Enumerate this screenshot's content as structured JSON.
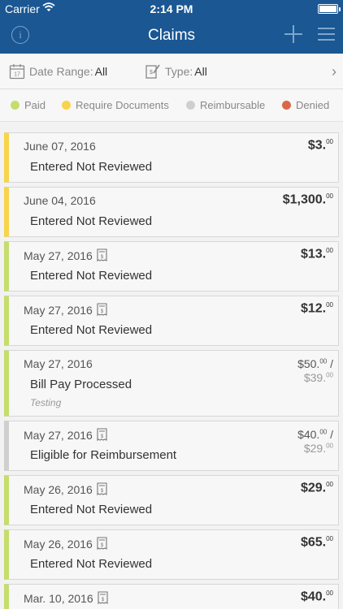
{
  "status_bar": {
    "carrier": "Carrier",
    "time": "2:14 PM"
  },
  "nav": {
    "title": "Claims",
    "info_icon": "info-icon",
    "add_icon": "plus-icon",
    "menu_icon": "hamburger-menu-icon"
  },
  "filters": {
    "date_range_label": "Date Range:",
    "date_range_value": "All",
    "type_label": "Type:",
    "type_value": "All"
  },
  "legend": [
    {
      "label": "Paid",
      "color": "#c5dd6c"
    },
    {
      "label": "Require Documents",
      "color": "#f7d44a"
    },
    {
      "label": "Reimbursable",
      "color": "#cfcfcf"
    },
    {
      "label": "Denied",
      "color": "#d9684b"
    }
  ],
  "claims": [
    {
      "date": "June 07, 2016",
      "status": "Entered Not Reviewed",
      "amount": "$3.",
      "cents": "00",
      "color": "#f7d44a",
      "receipt": false
    },
    {
      "date": "June 04, 2016",
      "status": "Entered Not Reviewed",
      "amount": "$1,300.",
      "cents": "00",
      "color": "#f7d44a",
      "receipt": false
    },
    {
      "date": "May 27, 2016",
      "status": "Entered Not Reviewed",
      "amount": "$13.",
      "cents": "00",
      "color": "#c5dd6c",
      "receipt": true
    },
    {
      "date": "May 27, 2016",
      "status": "Entered Not Reviewed",
      "amount": "$12.",
      "cents": "00",
      "color": "#c5dd6c",
      "receipt": true
    },
    {
      "date": "May 27, 2016",
      "status": "Bill Pay Processed",
      "note": "Testing",
      "amount": "$50.",
      "cents": "00",
      "slash": " /",
      "amount2": "$39.",
      "cents2": "00",
      "color": "#c5dd6c",
      "receipt": false
    },
    {
      "date": "May 27, 2016",
      "status": "Eligible for Reimbursement",
      "amount": "$40.",
      "cents": "00",
      "slash": " /",
      "amount2": "$29.",
      "cents2": "00",
      "color": "#cfcfcf",
      "receipt": true
    },
    {
      "date": "May 26, 2016",
      "status": "Entered Not Reviewed",
      "amount": "$29.",
      "cents": "00",
      "color": "#c5dd6c",
      "receipt": true
    },
    {
      "date": "May 26, 2016",
      "status": "Entered Not Reviewed",
      "amount": "$65.",
      "cents": "00",
      "color": "#c5dd6c",
      "receipt": true
    },
    {
      "date": "Mar. 10, 2016",
      "status": "",
      "amount": "$40.",
      "cents": "00",
      "color": "#c5dd6c",
      "receipt": true
    }
  ]
}
